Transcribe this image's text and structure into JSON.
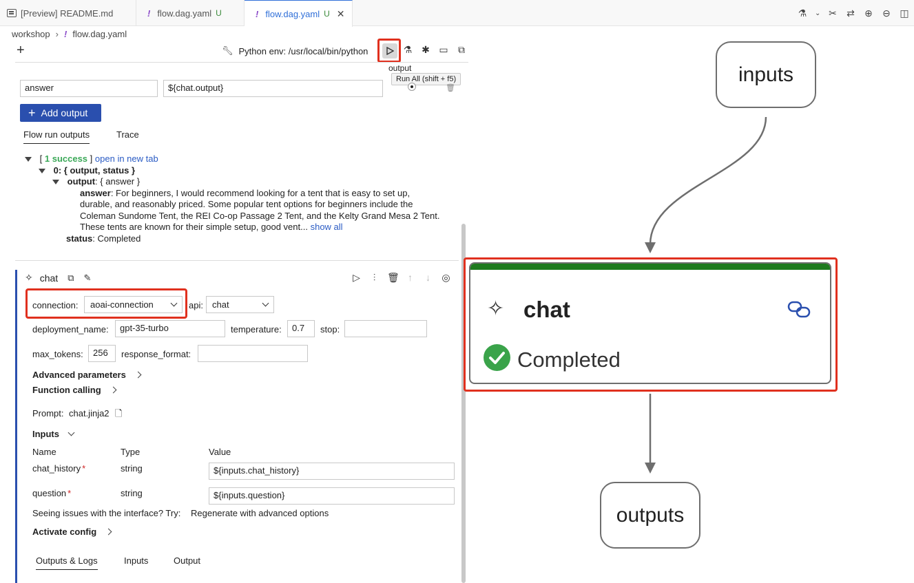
{
  "tabs": [
    {
      "label": "[Preview] README.md"
    },
    {
      "label": "flow.dag.yaml",
      "modified": "U"
    },
    {
      "label": "flow.dag.yaml",
      "modified": "U",
      "active": true
    }
  ],
  "breadcrumb": [
    "workshop",
    "flow.dag.yaml"
  ],
  "toolbar": {
    "python_env": "Python env: /usr/local/bin/python",
    "output_label": "output",
    "tooltip": "Run All (shift + f5)"
  },
  "outputs": {
    "name_value": "answer",
    "ref_value": "${chat.output}",
    "add_output_label": "Add output"
  },
  "run_tabs": [
    "Flow run outputs",
    "Trace"
  ],
  "results": {
    "bracket_open": "[",
    "success": "1 success",
    "bracket_close": "]",
    "open_link": "open in new tab",
    "item0": "0: { output, status }",
    "output_key": "output",
    "output_desc": ": { answer }",
    "answer_key": "answer",
    "answer_lines": [
      ": For beginners, I would recommend looking for a tent that is easy to set up,",
      "durable, and reasonably priced. Some popular tent options for beginners include the",
      "Coleman Sundome Tent, the REI Co-op Passage 2 Tent, and the Kelty Grand Mesa 2 Tent.",
      "These tents are known for their simple setup, good vent..."
    ],
    "show_all": "show all",
    "status_key": "status",
    "status_value": ": Completed"
  },
  "node": {
    "name": "chat",
    "connection_label": "connection:",
    "connection_value": "aoai-connection",
    "api_label": "api:",
    "api_value": "chat",
    "deployment_label": "deployment_name:",
    "deployment_value": "gpt-35-turbo",
    "temperature_label": "temperature:",
    "temperature_value": "0.7",
    "stop_label": "stop:",
    "stop_value": "",
    "max_tokens_label": "max_tokens:",
    "max_tokens_value": "256",
    "response_format_label": "response_format:",
    "response_format_value": "",
    "advanced_label": "Advanced parameters",
    "function_label": "Function calling",
    "prompt_label": "Prompt:",
    "prompt_file": "chat.jinja2",
    "inputs_label": "Inputs",
    "col_name": "Name",
    "col_type": "Type",
    "col_value": "Value",
    "inputs": [
      {
        "name": "chat_history",
        "type": "string",
        "value": "${inputs.chat_history}"
      },
      {
        "name": "question",
        "type": "string",
        "value": "${inputs.question}"
      }
    ],
    "issues_text": "Seeing issues with the interface? Try:",
    "regenerate_link": "Regenerate with advanced options",
    "activate_label": "Activate config",
    "bottom_tabs": [
      "Outputs & Logs",
      "Inputs",
      "Output"
    ]
  },
  "graph": {
    "inputs_node": "inputs",
    "chat_node": "chat",
    "chat_status": "Completed",
    "outputs_node": "outputs",
    "colors": {
      "success": "#3aa34a",
      "bar": "#1f7a1f",
      "highlight": "#e0301e",
      "edge": "#6e6e6e"
    }
  }
}
